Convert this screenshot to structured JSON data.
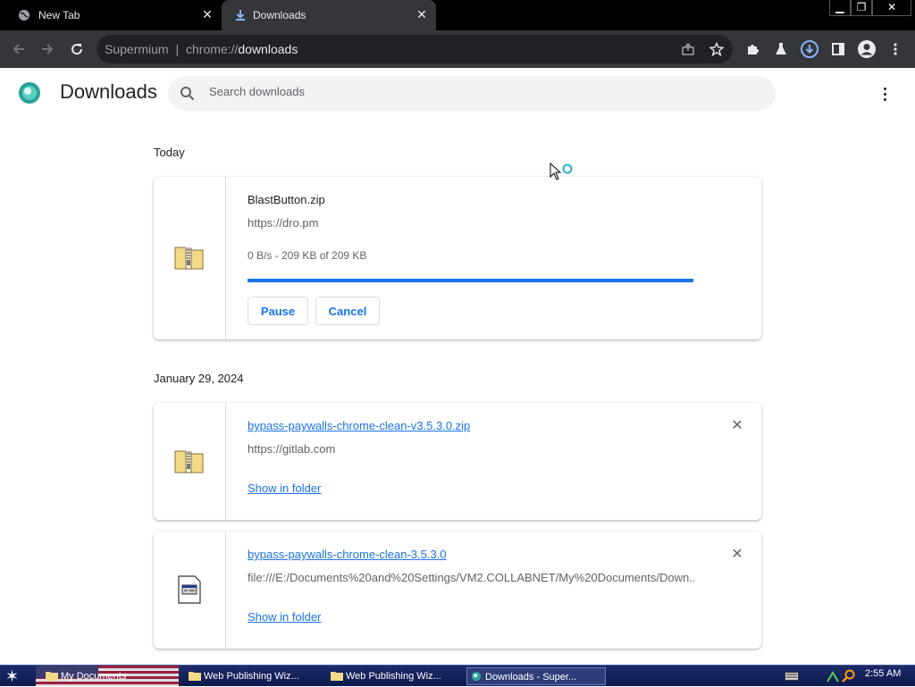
{
  "browser": {
    "tabs": [
      {
        "title": "New Tab",
        "icon": "globe-icon",
        "active": false
      },
      {
        "title": "Downloads",
        "icon": "download-icon",
        "active": true
      }
    ],
    "omnibox": {
      "prefix": "Supermium",
      "separator": "|",
      "scheme": "chrome://",
      "path": "downloads"
    },
    "accent": "#1a73e8"
  },
  "page": {
    "title": "Downloads",
    "search_placeholder": "Search downloads"
  },
  "sections": [
    {
      "label": "Today"
    },
    {
      "label": "January 29, 2024"
    }
  ],
  "downloads": [
    {
      "file_name": "BlastButton.zip",
      "url": "https://dro.pm",
      "status": "0 B/s - 209 KB of 209 KB",
      "progress": 1.0,
      "pause_label": "Pause",
      "cancel_label": "Cancel",
      "icon": "zip-folder-icon"
    },
    {
      "file_name": "bypass-paywalls-chrome-clean-v3.5.3.0.zip",
      "url": "https://gitlab.com",
      "action_label": "Show in folder",
      "icon": "zip-folder-icon"
    },
    {
      "file_name": "bypass-paywalls-chrome-clean-3.5.3.0",
      "url": "file:///E:/Documents%20and%20Settings/VM2.COLLABNET/My%20Documents/Down...",
      "action_label": "Show in folder",
      "icon": "document-file-icon"
    }
  ],
  "taskbar": {
    "tasks": [
      {
        "label": "My Documents"
      },
      {
        "label": "Web Publishing Wiz..."
      },
      {
        "label": "Web Publishing Wiz..."
      },
      {
        "label": "Downloads - Super..."
      }
    ],
    "clock": "2:55 AM"
  }
}
